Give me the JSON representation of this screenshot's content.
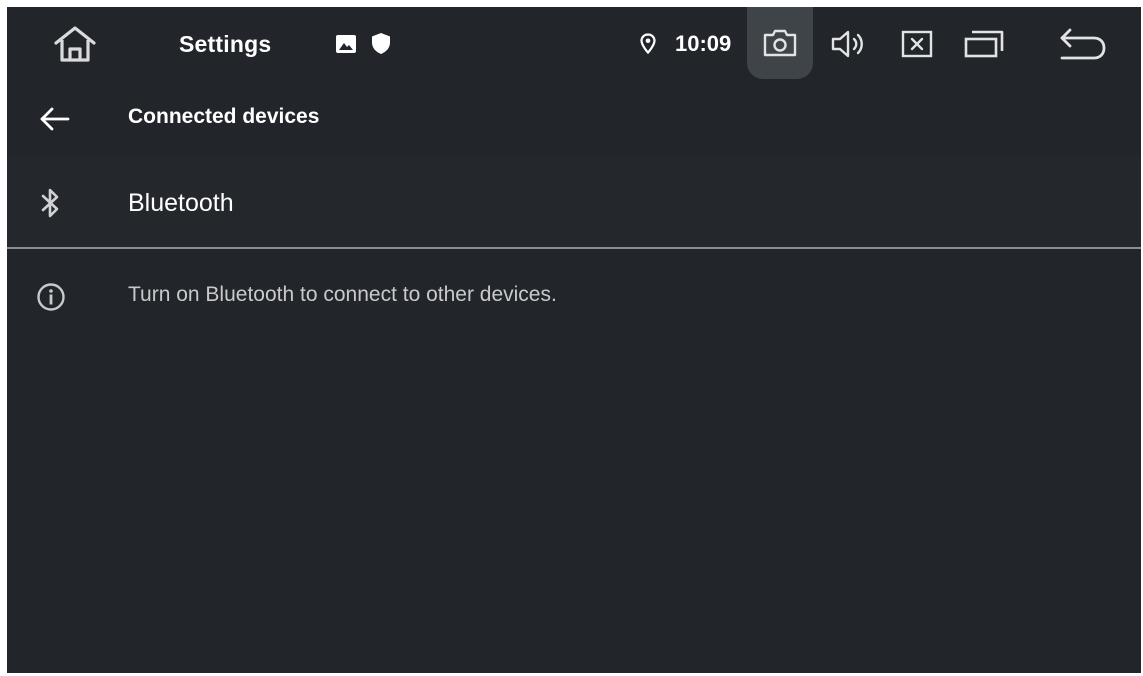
{
  "status_bar": {
    "home_icon": "home-icon",
    "app_title": "Settings",
    "notification_icons": [
      "gallery-icon",
      "shield-icon"
    ],
    "location_icon": "location-pin-icon",
    "time": "10:09",
    "buttons": [
      "camera-icon",
      "volume-icon",
      "close-box-icon",
      "recents-icon",
      "back-arrow-icon"
    ]
  },
  "app_bar": {
    "back_icon": "arrow-left-icon",
    "title": "Connected devices"
  },
  "list": {
    "items": [
      {
        "icon": "bluetooth-icon",
        "label": "Bluetooth"
      }
    ]
  },
  "info": {
    "icon": "info-icon",
    "text": "Turn on Bluetooth to connect to other devices."
  },
  "colors": {
    "background": "#22252a",
    "text_primary": "#ffffff",
    "text_secondary": "#c7c9cc",
    "highlight": "#3f4449",
    "divider": "#8a8d91"
  }
}
